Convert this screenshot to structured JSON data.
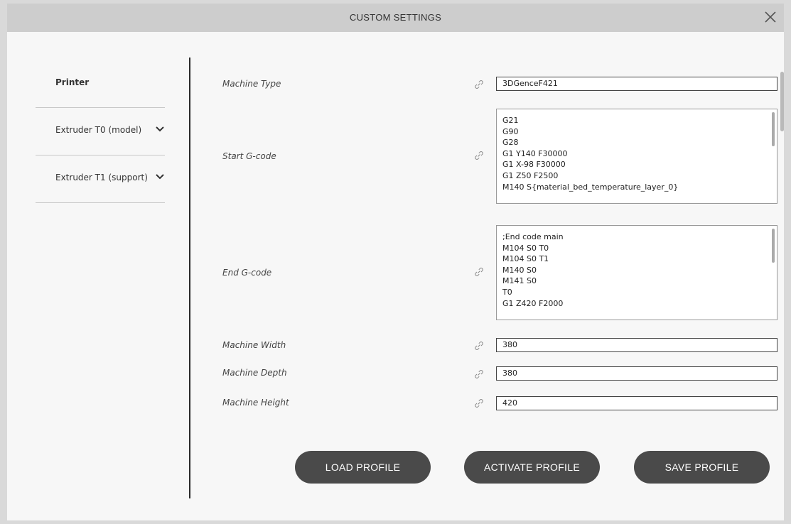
{
  "dialog": {
    "title": "CUSTOM SETTINGS"
  },
  "sidebar": {
    "items": [
      {
        "label": "Printer"
      },
      {
        "label": "Extruder T0 (model)"
      },
      {
        "label": "Extruder T1 (support)"
      }
    ]
  },
  "fields": {
    "machine_type": {
      "label": "Machine Type",
      "value": "3DGenceF421"
    },
    "start_gcode": {
      "label": "Start G-code",
      "lines": [
        "G21",
        "G90",
        "G28",
        "G1 Y140 F30000",
        "G1 X-98 F30000",
        "G1 Z50 F2500",
        "M140 S{material_bed_temperature_layer_0}"
      ]
    },
    "end_gcode": {
      "label": "End G-code",
      "lines": [
        ";End code main",
        "M104 S0 T0",
        "M104 S0 T1",
        "M140 S0",
        "M141 S0",
        "T0",
        "G1 Z420 F2000"
      ]
    },
    "machine_width": {
      "label": "Machine Width",
      "value": "380"
    },
    "machine_depth": {
      "label": "Machine Depth",
      "value": "380"
    },
    "machine_height": {
      "label": "Machine Height",
      "value": "420"
    }
  },
  "buttons": {
    "load": "LOAD PROFILE",
    "activate": "ACTIVATE PROFILE",
    "save": "SAVE PROFILE"
  },
  "icons": {
    "close": "close-icon",
    "link": "link-icon",
    "chevron": "chevron-down-icon"
  },
  "colors": {
    "titlebar": "#cdcdcd",
    "background": "#f7f7f7",
    "button": "#4a4a4a",
    "divider": "#2b2b2b"
  }
}
